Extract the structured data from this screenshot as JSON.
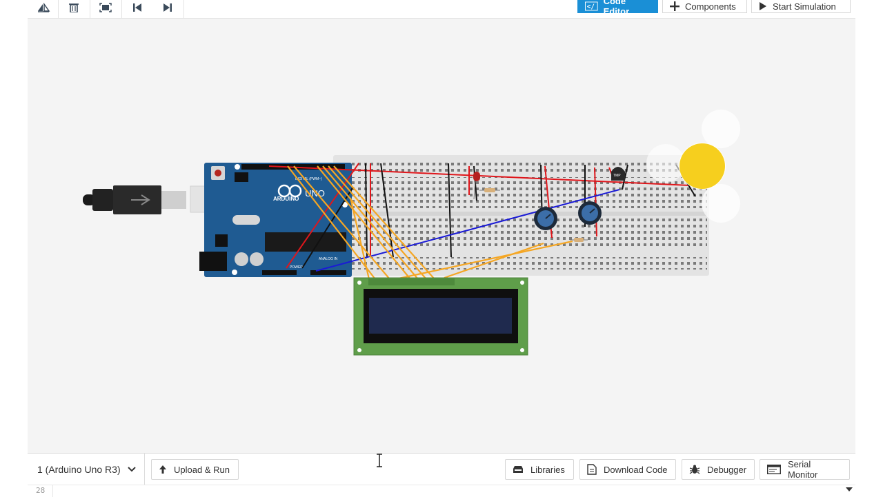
{
  "toolbar": {
    "code_editor_label": "Code Editor",
    "components_label": "Components",
    "start_simulation_label": "Start Simulation"
  },
  "canvas": {
    "arduino": {
      "brand": "ARDUINO",
      "model": "UNO",
      "digital_label": "DIGITAL (PWM~)",
      "analog_label": "ANALOG IN",
      "power_label": "POWER"
    },
    "temp_sensor_label": "TMP"
  },
  "codebar": {
    "board_select": "1 (Arduino Uno R3)",
    "upload_run_label": "Upload & Run",
    "libraries_label": "Libraries",
    "download_code_label": "Download Code",
    "debugger_label": "Debugger",
    "serial_monitor_label": "Serial Monitor"
  },
  "editor": {
    "line_number": "28"
  },
  "colors": {
    "accent": "#1a8fd6",
    "arduino_board": "#1f5b92",
    "breadboard": "#e4e4e4",
    "wire_red": "#e0161b",
    "wire_black": "#111111",
    "wire_blue": "#1a1ad6",
    "wire_orange": "#f5a623",
    "lcd_pcb": "#5f9e4a",
    "lcd_screen": "#1f2a4e",
    "light_source": "#f6cf1e"
  },
  "icons": [
    "flip-icon",
    "trash-icon",
    "fit-view-icon",
    "step-back-icon",
    "step-forward-icon",
    "code-icon",
    "plus-icon",
    "play-icon",
    "upload-icon",
    "library-icon",
    "file-icon",
    "bug-icon",
    "serial-monitor-icon",
    "chevron-down-icon",
    "text-cursor-icon"
  ]
}
